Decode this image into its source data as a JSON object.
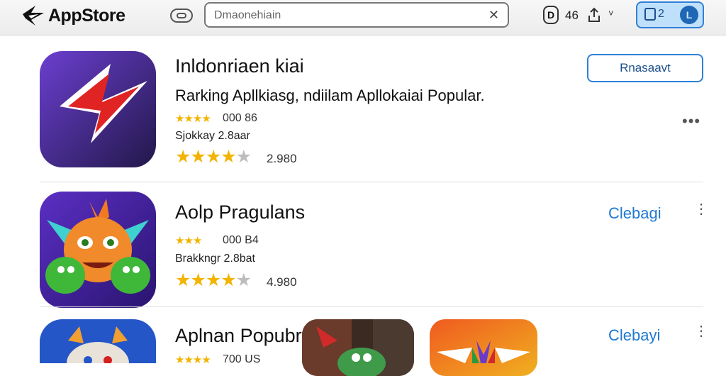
{
  "header": {
    "logo_text": "AppStore",
    "search_placeholder": "Dmaonehiain",
    "clear_glyph": "✕",
    "account_glyph": "D",
    "notification_count": "46",
    "chevron_glyph": "˅",
    "device_label": "2",
    "device_avatar_glyph": "L"
  },
  "apps": [
    {
      "title": "Inldonriaen kiai",
      "subtitle": "Rarking Apllkiasg, ndiilam Apllokaiai Popular.",
      "small_stars": "★★★★",
      "small_count": "000 86",
      "meta": "Sjokkay 2.8aar",
      "stars_on": "★★★★",
      "stars_off": "★",
      "rating": "2.980",
      "action": "Rnasaavt",
      "more": "•••"
    },
    {
      "title": "Aolp Pragulans",
      "small_stars": "★★★",
      "small_count": "000 B4",
      "meta": "Brakkngr 2.8bat",
      "stars_on": "★★★★",
      "stars_off": "★",
      "rating": "4.980",
      "action": "Clebagi",
      "more": "⋮"
    },
    {
      "title": "Aplnan Popubr",
      "small_stars": "★★★★",
      "small_count": "700 US",
      "action": "Clebayi",
      "more": "⋮"
    }
  ],
  "colors": {
    "accent": "#2f80d8",
    "link": "#1f78d1",
    "star": "#f2b400",
    "star_empty": "#bdbdbd",
    "device_pill_bg": "#bfe0fb"
  },
  "icons": {
    "logo": "app-store-logo-icon",
    "tabs": "tab-toggle-icon",
    "share": "share-icon",
    "app1": "red-arrow-icon",
    "app2": "monster-character-icon",
    "app3": "blue-creature-icon"
  }
}
